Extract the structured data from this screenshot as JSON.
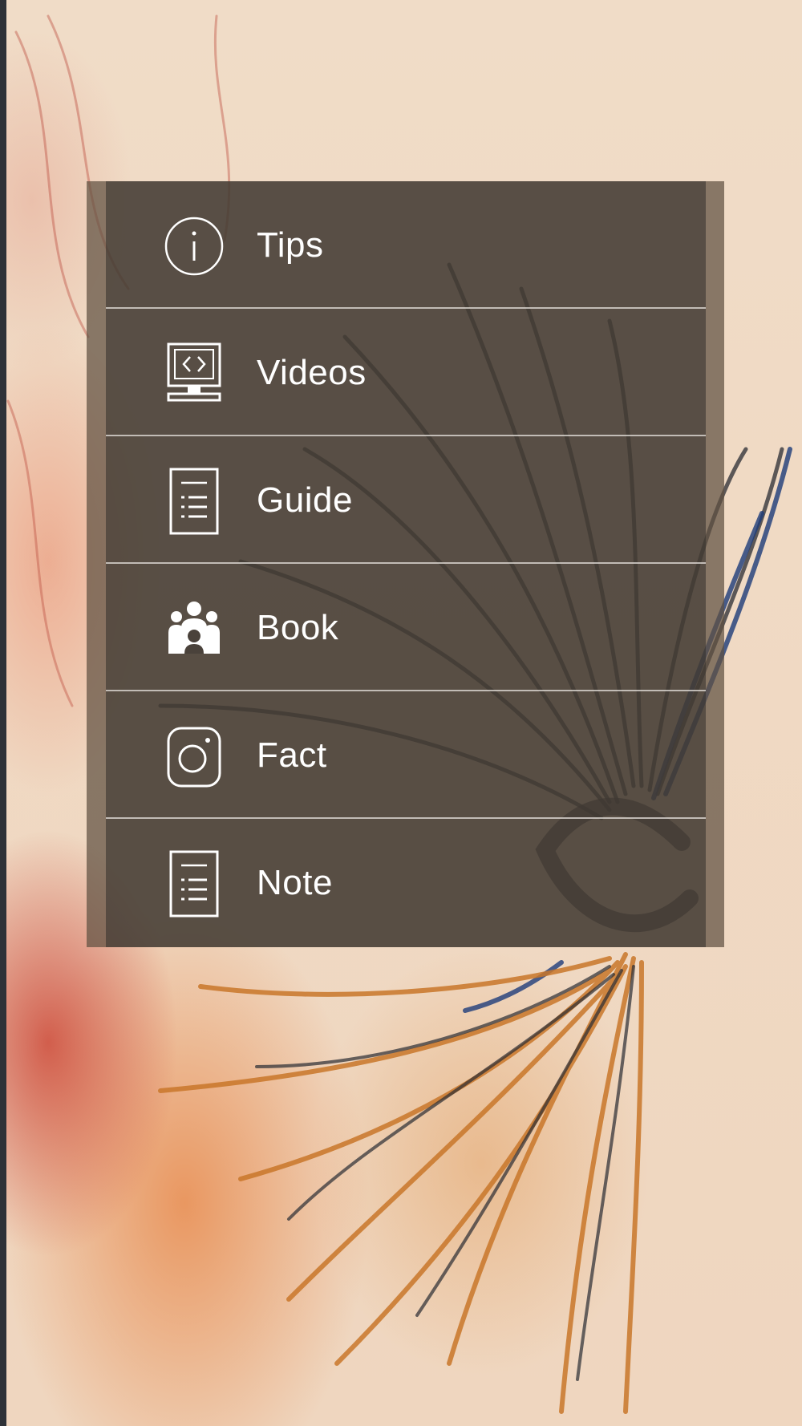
{
  "menu": {
    "items": [
      {
        "label": "Tips",
        "icon": "info-icon"
      },
      {
        "label": "Videos",
        "icon": "monitor-code-icon"
      },
      {
        "label": "Guide",
        "icon": "document-list-icon"
      },
      {
        "label": "Book",
        "icon": "people-group-icon"
      },
      {
        "label": "Fact",
        "icon": "instagram-icon"
      },
      {
        "label": "Note",
        "icon": "document-list-icon"
      }
    ]
  },
  "colors": {
    "background": "#efd9c3",
    "panel_overlay": "#5f5041",
    "text": "#ffffff"
  }
}
